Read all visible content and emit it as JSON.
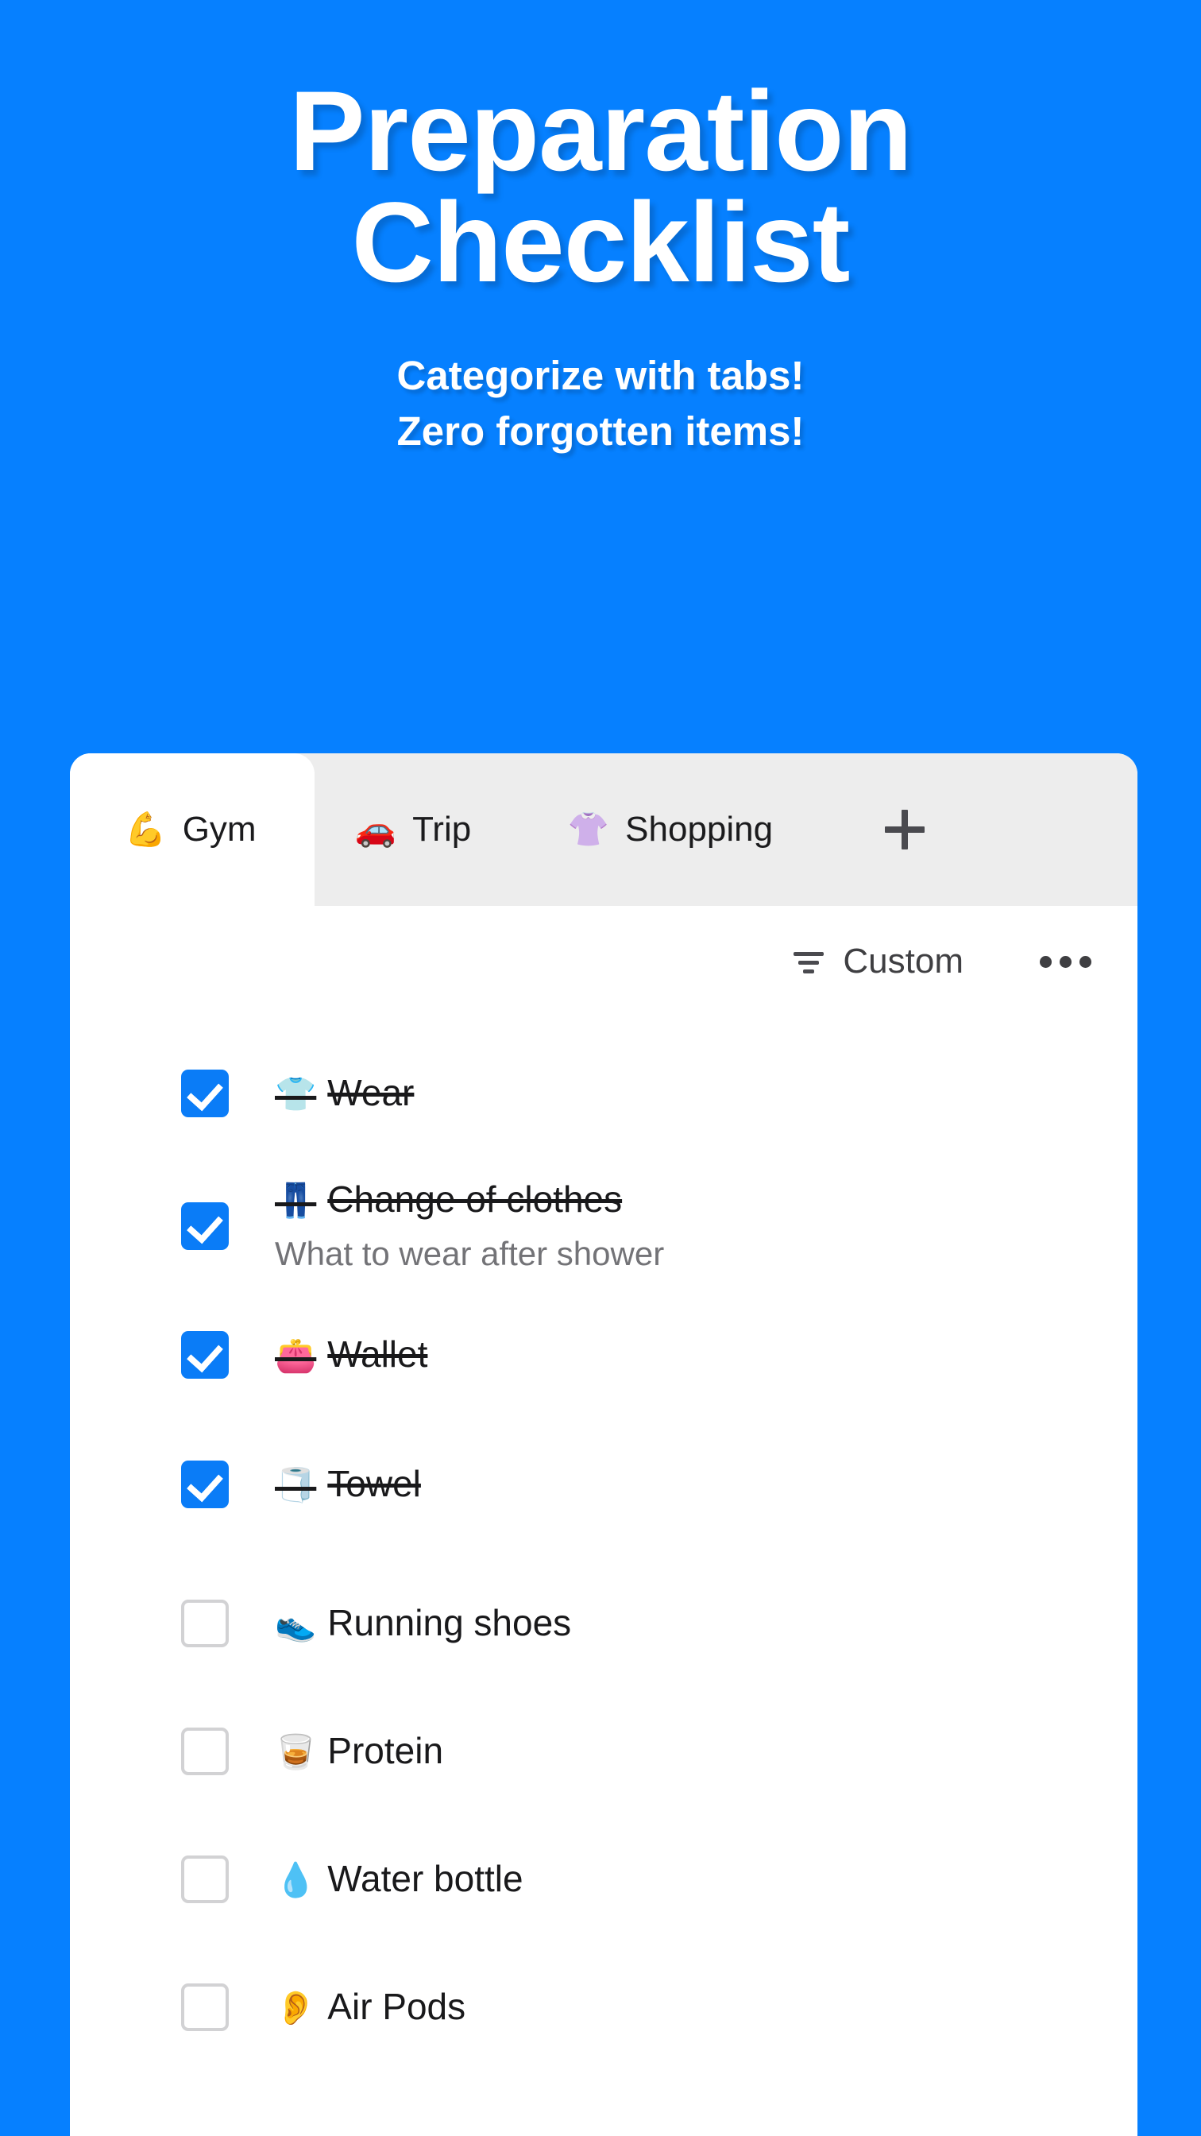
{
  "hero": {
    "title_line1": "Preparation",
    "title_line2": "Checklist",
    "sub_line1": "Categorize with tabs!",
    "sub_line2": "Zero forgotten items!"
  },
  "colors": {
    "background_blue": "#0680ff",
    "checkbox_blue": "#0a7cf7",
    "tabbar_gray": "#ededed",
    "card_white": "#ffffff",
    "note_gray": "#737377",
    "icon_gray": "#4a4a4f"
  },
  "tabs": [
    {
      "emoji": "💪",
      "label": "Gym",
      "active": true
    },
    {
      "emoji": "🚗",
      "label": "Trip",
      "active": false
    },
    {
      "emoji": "👚",
      "label": "Shopping",
      "active": false
    }
  ],
  "add_tab_label": "+",
  "toolbar": {
    "sort_label": "Custom",
    "sort_icon": "sort-lines-icon",
    "more_icon": "more-horizontal-icon"
  },
  "checklist": {
    "items": [
      {
        "emoji": "👕",
        "title": "Wear",
        "note": "",
        "checked": true
      },
      {
        "emoji": "👖",
        "title": "Change of clothes",
        "note": "What to wear after shower",
        "checked": true
      },
      {
        "emoji": "👛",
        "title": "Wallet",
        "note": "",
        "checked": true
      },
      {
        "emoji": "🧻",
        "title": "Towel",
        "note": "",
        "checked": true
      },
      {
        "emoji": "👟",
        "title": "Running shoes",
        "note": "",
        "checked": false
      },
      {
        "emoji": "🥃",
        "title": "Protein",
        "note": "",
        "checked": false
      },
      {
        "emoji": "💧",
        "title": "Water bottle",
        "note": "",
        "checked": false
      },
      {
        "emoji": "👂",
        "title": "Air Pods",
        "note": "",
        "checked": false
      }
    ]
  }
}
